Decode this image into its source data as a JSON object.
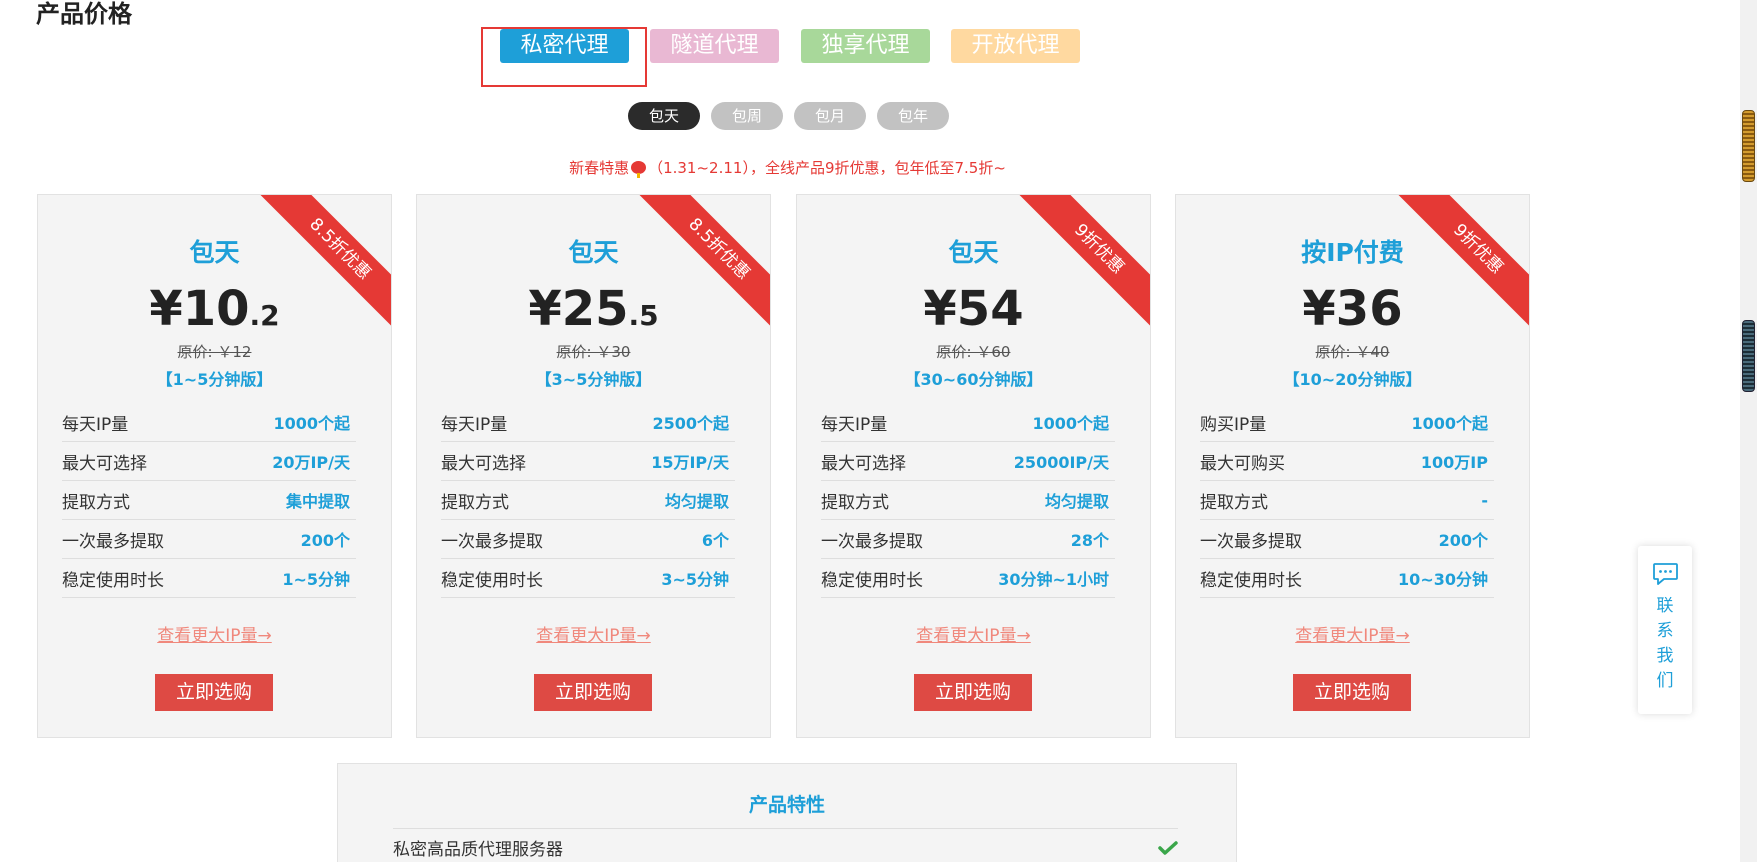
{
  "page_title": "产品价格",
  "colors": {
    "blue": "#1e9fd8",
    "red": "#e53935",
    "pink": "#e9b8d3",
    "green": "#a8d89a",
    "orange": "#ffd9a0",
    "dark": "#2b2b2b",
    "gray": "#c2c2c2"
  },
  "product_tabs": [
    {
      "label": "私密代理",
      "active": true
    },
    {
      "label": "隧道代理",
      "active": false
    },
    {
      "label": "独享代理",
      "active": false
    },
    {
      "label": "开放代理",
      "active": false
    }
  ],
  "period_tabs": [
    {
      "label": "包天",
      "active": true
    },
    {
      "label": "包周",
      "active": false
    },
    {
      "label": "包月",
      "active": false
    },
    {
      "label": "包年",
      "active": false
    }
  ],
  "promo": {
    "prefix": "新春特惠",
    "icon": "lantern-icon",
    "suffix": "（1.31~2.11），全线产品9折优惠，包年低至7.5折~"
  },
  "cards": [
    {
      "ribbon": "8.5折优惠",
      "title": "包天",
      "price_main": "¥10",
      "price_decimal": ".2",
      "original_price": "原价: ￥12",
      "version": "【1~5分钟版】",
      "features": [
        {
          "label": "每天IP量",
          "value": "1000个起"
        },
        {
          "label": "最大可选择",
          "value": "20万IP/天"
        },
        {
          "label": "提取方式",
          "value": "集中提取"
        },
        {
          "label": "一次最多提取",
          "value": "200个"
        },
        {
          "label": "稳定使用时长",
          "value": "1~5分钟"
        }
      ],
      "more_link": "查看更大IP量→",
      "buy_label": "立即选购"
    },
    {
      "ribbon": "8.5折优惠",
      "title": "包天",
      "price_main": "¥25",
      "price_decimal": ".5",
      "original_price": "原价: ￥30",
      "version": "【3~5分钟版】",
      "features": [
        {
          "label": "每天IP量",
          "value": "2500个起"
        },
        {
          "label": "最大可选择",
          "value": "15万IP/天"
        },
        {
          "label": "提取方式",
          "value": "均匀提取"
        },
        {
          "label": "一次最多提取",
          "value": "6个"
        },
        {
          "label": "稳定使用时长",
          "value": "3~5分钟"
        }
      ],
      "more_link": "查看更大IP量→",
      "buy_label": "立即选购"
    },
    {
      "ribbon": "9折优惠",
      "title": "包天",
      "price_main": "¥54",
      "price_decimal": "",
      "original_price": "原价: ￥60",
      "version": "【30~60分钟版】",
      "features": [
        {
          "label": "每天IP量",
          "value": "1000个起"
        },
        {
          "label": "最大可选择",
          "value": "25000IP/天"
        },
        {
          "label": "提取方式",
          "value": "均匀提取"
        },
        {
          "label": "一次最多提取",
          "value": "28个"
        },
        {
          "label": "稳定使用时长",
          "value": "30分钟~1小时"
        }
      ],
      "more_link": "查看更大IP量→",
      "buy_label": "立即选购"
    },
    {
      "ribbon": "9折优惠",
      "title": "按IP付费",
      "price_main": "¥36",
      "price_decimal": "",
      "original_price": "原价: ￥40",
      "version": "【10~20分钟版】",
      "features": [
        {
          "label": "购买IP量",
          "value": "1000个起"
        },
        {
          "label": "最大可购买",
          "value": "100万IP"
        },
        {
          "label": "提取方式",
          "value": "-"
        },
        {
          "label": "一次最多提取",
          "value": "200个"
        },
        {
          "label": "稳定使用时长",
          "value": "10~30分钟"
        }
      ],
      "more_link": "查看更大IP量→",
      "buy_label": "立即选购"
    }
  ],
  "specs": {
    "title": "产品特性",
    "rows": [
      {
        "label": "私密高品质代理服务器",
        "icon": "check-icon"
      }
    ]
  },
  "contact": {
    "icon": "chat-icon",
    "chars": [
      "联",
      "系",
      "我",
      "们"
    ]
  }
}
